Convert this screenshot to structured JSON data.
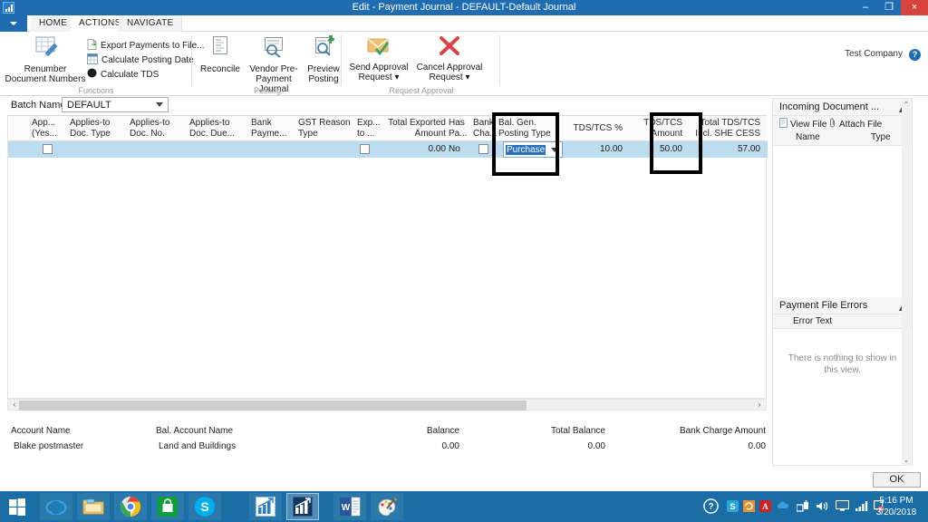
{
  "window": {
    "title": "Edit - Payment Journal - DEFAULT-Default Journal",
    "app_icon": "chart-app-icon",
    "minimize": "–",
    "maximize": "❐",
    "close": "×",
    "company": "Test Company",
    "help": "?"
  },
  "ribbon": {
    "quick_access_caret": "▾",
    "tabs": [
      {
        "label": "HOME",
        "active": false
      },
      {
        "label": "ACTIONS",
        "active": true
      },
      {
        "label": "NAVIGATE",
        "active": false
      }
    ],
    "groups": [
      {
        "name": "Functions",
        "label": "Functions",
        "big_buttons": [
          {
            "label_line1": "Renumber",
            "label_line2": "Document Numbers",
            "icon": "grid-pencil-icon"
          }
        ],
        "small_buttons": [
          {
            "label": "Export Payments to File...",
            "icon": "page-export-icon"
          },
          {
            "label": "Calculate Posting Date",
            "icon": "calendar-grid-icon"
          },
          {
            "label": "Calculate TDS",
            "icon": "black-circle-icon"
          }
        ]
      },
      {
        "name": "Posting",
        "label": "Posting",
        "big_buttons": [
          {
            "label_line1": "Reconcile",
            "label_line2": "",
            "icon": "document-lines-icon"
          },
          {
            "label_line1": "Vendor Pre-",
            "label_line2": "Payment Journal",
            "icon": "document-magnifier-icon"
          },
          {
            "label_line1": "Preview",
            "label_line2": "Posting",
            "icon": "preview-magnifier-icon"
          }
        ],
        "small_buttons": []
      },
      {
        "name": "Request Approval",
        "label": "Request Approval",
        "big_buttons": [
          {
            "label_line1": "Send Approval",
            "label_line2": "Request ▾",
            "icon": "envelope-check-icon"
          },
          {
            "label_line1": "Cancel Approval",
            "label_line2": "Request ▾",
            "icon": "red-x-icon"
          }
        ],
        "small_buttons": []
      }
    ]
  },
  "batch": {
    "label": "Batch Name:",
    "value": "DEFAULT",
    "dropdown_icon": "chevron-down-icon"
  },
  "grid": {
    "columns": [
      {
        "key": "applied",
        "line1": "App...",
        "line2": "(Yes...",
        "align": "left",
        "type": "checkbox"
      },
      {
        "key": "applies_to_doc_type",
        "line1": "Applies-to",
        "line2": "Doc. Type",
        "align": "left",
        "type": "text"
      },
      {
        "key": "applies_to_doc_no",
        "line1": "Applies-to",
        "line2": "Doc. No.",
        "align": "left",
        "type": "text"
      },
      {
        "key": "applies_to_doc_due",
        "line1": "Applies-to",
        "line2": "Doc. Due...",
        "align": "left",
        "type": "text"
      },
      {
        "key": "bank_payment",
        "line1": "Bank",
        "line2": "Payme...",
        "align": "left",
        "type": "text"
      },
      {
        "key": "gst_reason_type",
        "line1": "GST Reason",
        "line2": "Type",
        "align": "left",
        "type": "text"
      },
      {
        "key": "exported_to",
        "line1": "Exp...",
        "line2": "to ...",
        "align": "left",
        "type": "checkbox"
      },
      {
        "key": "total_exported_amount",
        "line1": "Total Exported",
        "line2": "Amount",
        "align": "right",
        "type": "text"
      },
      {
        "key": "has_payment",
        "line1": "Has",
        "line2": "Pa...",
        "align": "left",
        "type": "text"
      },
      {
        "key": "bank_charge",
        "line1": "Bank",
        "line2": "Cha...",
        "align": "left",
        "type": "checkbox"
      },
      {
        "key": "bal_gen_posting_type",
        "line1": "Bal. Gen.",
        "line2": "Posting Type",
        "align": "left",
        "type": "combo"
      },
      {
        "key": "tds_tcs_percent",
        "line1": "TDS/TCS %",
        "line2": "",
        "align": "right",
        "type": "text"
      },
      {
        "key": "tds_tcs_amount",
        "line1": "TDS/TCS",
        "line2": "Amount",
        "align": "right",
        "type": "text"
      },
      {
        "key": "total_tds_tcs_she_cess",
        "line1": "Total TDS/TCS",
        "line2": "Incl. SHE CESS",
        "align": "right",
        "type": "text"
      }
    ],
    "row": {
      "applied": false,
      "applies_to_doc_type": "",
      "applies_to_doc_no": "",
      "applies_to_doc_due": "",
      "bank_payment": "",
      "gst_reason_type": "",
      "exported_to": false,
      "total_exported_amount": "0.00",
      "has_payment": "No",
      "bank_charge": false,
      "bal_gen_posting_type": "Purchase",
      "tds_tcs_percent": "10.00",
      "tds_tcs_amount": "50.00",
      "total_tds_tcs_she_cess": "57.00"
    },
    "highlights": [
      {
        "name": "bal-gen-posting-type-highlight",
        "color": "#000000"
      },
      {
        "name": "tds-tcs-amount-highlight",
        "color": "#000000"
      }
    ],
    "scroll_left_arrow": "‹",
    "scroll_right_arrow": "›"
  },
  "totals": [
    {
      "header": "Account Name",
      "value": "Blake postmaster",
      "align": "left"
    },
    {
      "header": "Bal. Account Name",
      "value": "Land and Buildings",
      "align": "left"
    },
    {
      "header": "Balance",
      "value": "0.00",
      "align": "right"
    },
    {
      "header": "Total Balance",
      "value": "0.00",
      "align": "right"
    },
    {
      "header": "Bank Charge Amount",
      "value": "0.00",
      "align": "right"
    }
  ],
  "sidebar": {
    "incoming_document": {
      "title": "Incoming Document ...",
      "collapse_icon": "chevron-up-icon",
      "actions": [
        {
          "label": "View File",
          "icon": "file-icon"
        },
        {
          "label": "Attach File",
          "icon": "paperclip-icon"
        }
      ],
      "more": "»",
      "columns": [
        "Name",
        "Type"
      ]
    },
    "payment_file_errors": {
      "title": "Payment File Errors",
      "collapse_icon": "chevron-up-icon",
      "columns": [
        "Error Text"
      ],
      "empty_message": "There is nothing to show in this view."
    },
    "scroll_up_arrow": "⌃",
    "scroll_down_arrow": "⌄"
  },
  "dialog": {
    "ok_label": "OK"
  },
  "taskbar": {
    "start_icon": "windows-start-icon",
    "items": [
      {
        "name": "internet-explorer-icon",
        "active": false
      },
      {
        "name": "file-explorer-icon",
        "active": false
      },
      {
        "name": "google-chrome-icon",
        "active": false
      },
      {
        "name": "windows-store-icon",
        "active": false
      },
      {
        "name": "skype-icon",
        "active": false
      },
      {
        "name": "dynamics-nav-icon",
        "active": false
      },
      {
        "name": "dynamics-nav-window-icon",
        "active": true
      },
      {
        "name": "microsoft-word-icon",
        "active": false
      },
      {
        "name": "paint-icon",
        "active": false
      }
    ],
    "tray": [
      {
        "name": "action-center-help-icon"
      },
      {
        "name": "skype-tray-icon"
      },
      {
        "name": "update-tray-icon"
      },
      {
        "name": "adobe-tray-icon"
      },
      {
        "name": "onedrive-tray-icon"
      },
      {
        "name": "network-tray-icon"
      },
      {
        "name": "volume-tray-icon"
      },
      {
        "name": "display-tray-icon"
      },
      {
        "name": "signal-tray-icon"
      },
      {
        "name": "flag-alert-tray-icon"
      }
    ],
    "time": "5:16 PM",
    "date": "3/20/2018"
  }
}
